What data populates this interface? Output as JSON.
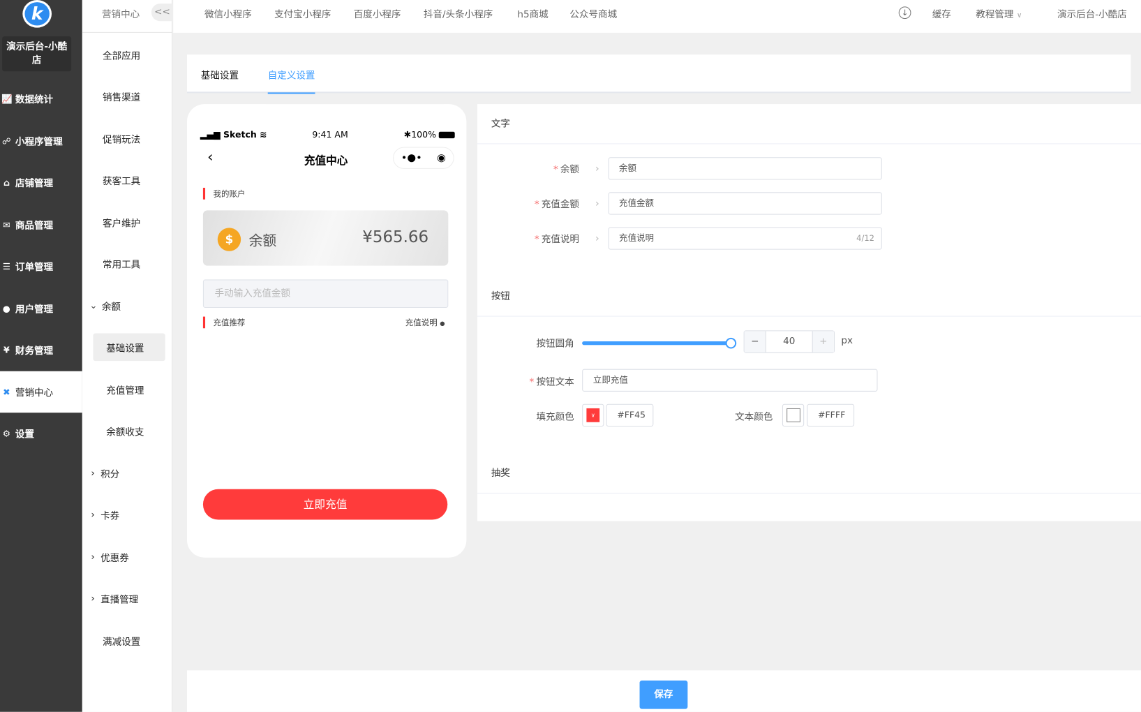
{
  "sidebar": {
    "logo": "k",
    "shop_name": "演示后台-小酷店",
    "items": [
      {
        "label": "数据统计",
        "icon": "chart-icon"
      },
      {
        "label": "小程序管理",
        "icon": "link-icon"
      },
      {
        "label": "店铺管理",
        "icon": "shop-icon"
      },
      {
        "label": "商品管理",
        "icon": "goods-icon"
      },
      {
        "label": "订单管理",
        "icon": "order-icon"
      },
      {
        "label": "用户管理",
        "icon": "user-icon"
      },
      {
        "label": "财务管理",
        "icon": "finance-icon"
      },
      {
        "label": "营销中心",
        "icon": "marketing-icon"
      },
      {
        "label": "设置",
        "icon": "gear-icon"
      }
    ]
  },
  "submenu": {
    "title": "营销中心",
    "collapse": "<<",
    "items": [
      "全部应用",
      "销售渠道",
      "促销玩法",
      "获客工具",
      "客户维护",
      "常用工具"
    ],
    "balance_group": "余额",
    "balance_children": [
      "基础设置",
      "充值管理",
      "余额收支"
    ],
    "groups": [
      "积分",
      "卡券",
      "优惠券",
      "直播管理"
    ],
    "last": "满减设置"
  },
  "topnav": {
    "items": [
      "微信小程序",
      "支付宝小程序",
      "百度小程序",
      "抖音/头条小程序",
      "h5商城",
      "公众号商城"
    ],
    "cache": "缓存",
    "tutorial": "教程管理",
    "account": "演示后台-小酷店"
  },
  "tabs": [
    "基础设置",
    "自定义设置"
  ],
  "phone": {
    "carrier": "Sketch",
    "time": "9:41 AM",
    "battery": "100%",
    "title": "充值中心",
    "my_account": "我的账户",
    "balance_label": "余额",
    "balance_value": "¥565.66",
    "input_placeholder": "手动输入充值金额",
    "recommend": "充值推荐",
    "explain": "充值说明",
    "button": "立即充值"
  },
  "form": {
    "text_section": "文字",
    "fields": [
      {
        "label": "余额",
        "value": "余额"
      },
      {
        "label": "充值金额",
        "value": "充值金额"
      },
      {
        "label": "充值说明",
        "value": "充值说明",
        "count": "4/12"
      }
    ],
    "button_section": "按钮",
    "radius_label": "按钮圆角",
    "radius_value": "40",
    "radius_fraction": 1.0,
    "unit": "px",
    "minus": "−",
    "plus": "+",
    "button_text_label": "按钮文本",
    "button_text": "立即充值",
    "fill_label": "填充颜色",
    "fill_value": "#FF45",
    "text_color_label": "文本颜色",
    "text_color_value": "#FFFF",
    "lottery_section": "抽奖"
  },
  "colors": {
    "fill": "#ff3b3b",
    "accent": "#409eff"
  },
  "save": "保存"
}
